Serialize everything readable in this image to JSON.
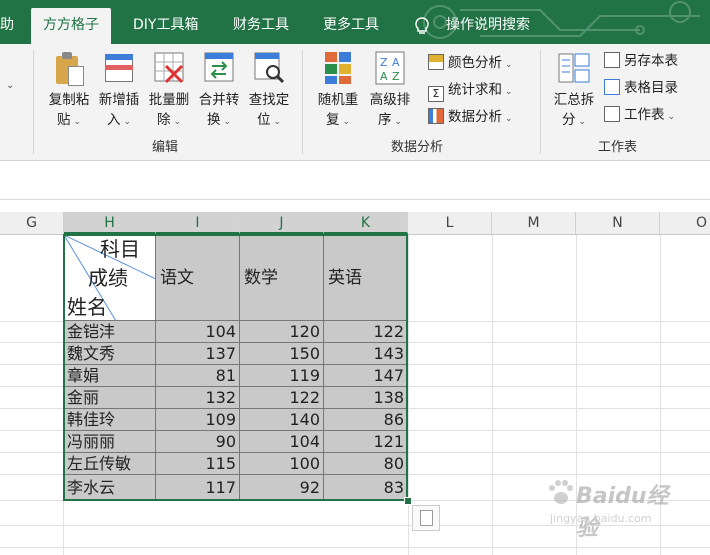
{
  "tabs": {
    "help_partial": "助",
    "active": "方方格子",
    "diy": "DIY工具箱",
    "finance": "财务工具",
    "more": "更多工具",
    "search": "操作说明搜索"
  },
  "ribbon": {
    "edit_group": {
      "label": "编辑",
      "copy_paste": [
        "复制粘",
        "贴"
      ],
      "add_insert": [
        "新增插",
        "入"
      ],
      "batch_delete": [
        "批量删",
        "除"
      ],
      "merge_convert": [
        "合并转",
        "换"
      ],
      "find_locate": [
        "查找定",
        "位"
      ]
    },
    "data_group": {
      "label": "数据分析",
      "random_repeat": [
        "随机重",
        "复"
      ],
      "advanced_sort": [
        "高级排",
        "序"
      ],
      "color_analysis": "颜色分析",
      "stat_sum": "统计求和",
      "data_analysis": "数据分析"
    },
    "sheet_group": {
      "label": "工作表",
      "summary_split": [
        "汇总拆",
        "分"
      ],
      "save_this": "另存本表",
      "table_dir": "表格目录",
      "worksheet": "工作表"
    }
  },
  "columns": [
    "G",
    "H",
    "I",
    "J",
    "K",
    "L",
    "M",
    "N",
    "O"
  ],
  "table": {
    "corner": {
      "subject": "科目",
      "score": "成绩",
      "name": "姓名"
    },
    "headers": [
      "语文",
      "数学",
      "英语"
    ],
    "rows": [
      {
        "name": "金铠沣",
        "chinese": "104",
        "math": "120",
        "english": "122"
      },
      {
        "name": "魏文秀",
        "chinese": "137",
        "math": "150",
        "english": "143"
      },
      {
        "name": "章娟",
        "chinese": "81",
        "math": "119",
        "english": "147"
      },
      {
        "name": "金丽",
        "chinese": "132",
        "math": "122",
        "english": "138"
      },
      {
        "name": "韩佳玲",
        "chinese": "109",
        "math": "140",
        "english": "86"
      },
      {
        "name": "冯丽丽",
        "chinese": "90",
        "math": "104",
        "english": "121"
      },
      {
        "name": "左丘传敏",
        "chinese": "115",
        "math": "100",
        "english": "80"
      },
      {
        "name": "李水云",
        "chinese": "117",
        "math": "92",
        "english": "83"
      }
    ]
  },
  "watermark": {
    "brand": "Baidu经验",
    "url": "jingyan.baidu.com"
  },
  "colors": {
    "excel_green": "#217346",
    "selected_fill": "#c9c9c9"
  }
}
